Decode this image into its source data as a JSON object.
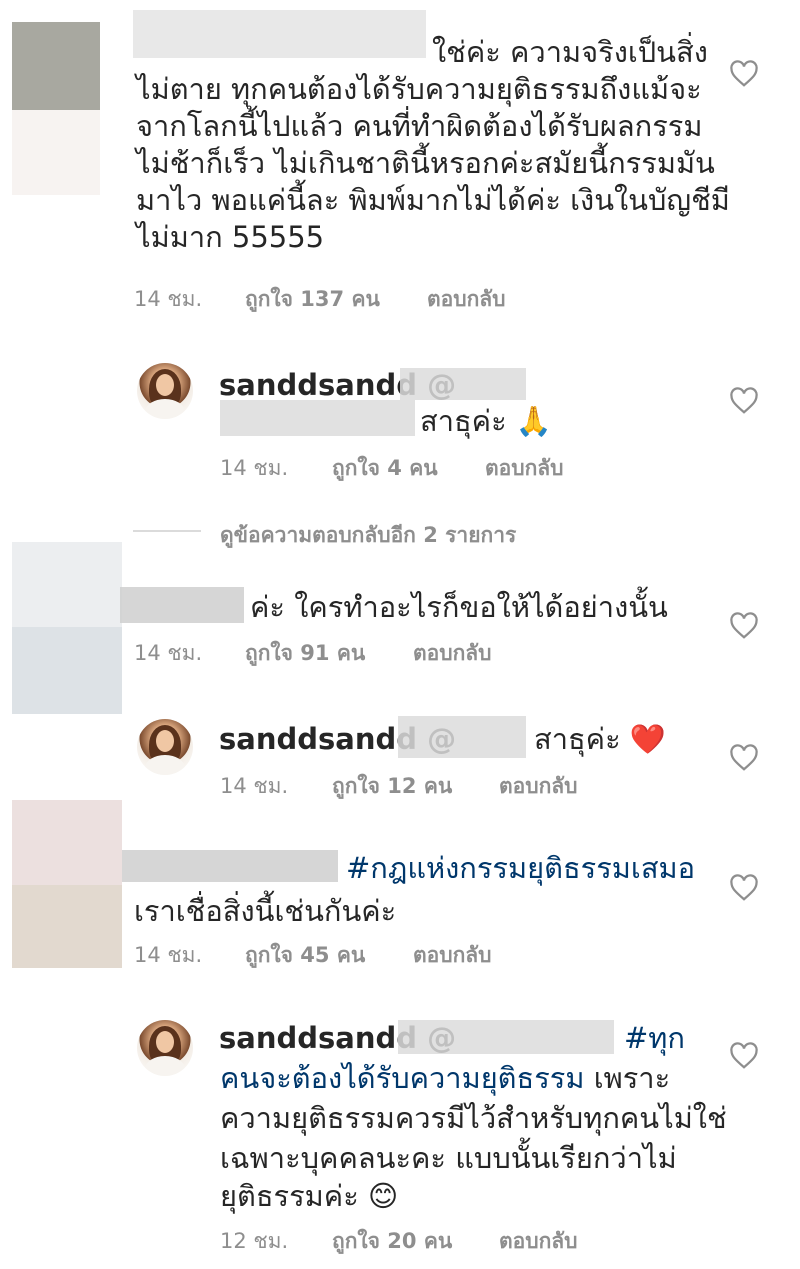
{
  "comments": [
    {
      "lines": [
        "ใช่ค่ะ ความจริงเป็นสิ่ง",
        "ไม่ตาย ทุกคนต้องได้รับความยุติธรรมถึงแม้จะ",
        "จากโลกนี้ไปแล้ว คนที่ทำผิดต้องได้รับผลกรรม",
        "ไม่ช้าก็เร็ว ไม่เกินชาตินี้หรอกค่ะสมัยนี้กรรมมัน",
        "มาไว  พอแค่นี้ละ พิมพ์มากไม่ได้ค่ะ เงินในบัญชีมี",
        "ไม่มาก 55555"
      ],
      "time": "14 ชม.",
      "likes": "ถูกใจ 137 คน",
      "reply": "ตอบกลับ"
    },
    {
      "username": "sanddsandd @",
      "text": "สาธุค่ะ 🙏",
      "time": "14 ชม.",
      "likes": "ถูกใจ 4 คน",
      "reply": "ตอบกลับ"
    },
    {
      "view_more": "ดูข้อความตอบกลับอีก 2 รายการ"
    },
    {
      "text": "ค่ะ ใครทำอะไรก็ขอให้ได้อย่างนั้น",
      "time": "14 ชม.",
      "likes": "ถูกใจ 91 คน",
      "reply": "ตอบกลับ"
    },
    {
      "username": "sanddsandd @",
      "text": "สาธุค่ะ ❤️",
      "time": "14 ชม.",
      "likes": "ถูกใจ 12 คน",
      "reply": "ตอบกลับ"
    },
    {
      "hashtag": "#กฎแห่งกรรมยุติธรรมเสมอ",
      "line2": "เราเชื่อสิ่งนี้เช่นกันค่ะ",
      "time": "14 ชม.",
      "likes": "ถูกใจ 45 คน",
      "reply": "ตอบกลับ"
    },
    {
      "username": "sanddsandd @",
      "hashtag1": "#ทุก",
      "hashtag2": "คนจะต้องได้รับความยุติธรรม",
      "line2_rest": " เพราะ",
      "lines": [
        "ความยุติธรรมควรมีไว้สำหรับทุกคนไม่ใช่",
        "เฉพาะบุคคลนะคะ แบบนั้นเรียกว่าไม่",
        "ยุติธรรมค่ะ 😊"
      ],
      "time": "12 ชม.",
      "likes": "ถูกใจ 20 คน",
      "reply": "ตอบกลับ"
    }
  ],
  "icons": {
    "heart": "heart-outline-icon"
  },
  "colors": {
    "text": "#262626",
    "meta": "#8e8e8e",
    "hashtag": "#00376b"
  }
}
